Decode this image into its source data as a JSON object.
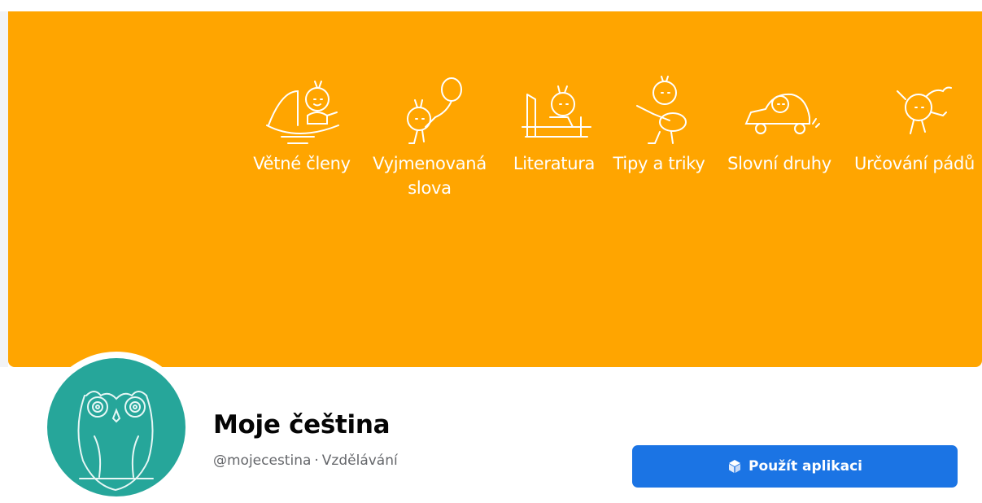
{
  "cover": {
    "background": "#FFA500",
    "categories": [
      {
        "label": "Větné členy",
        "icon": "boat-figure-icon"
      },
      {
        "label": "Vyjmenovaná slova",
        "icon": "balloon-figure-icon"
      },
      {
        "label": "Literatura",
        "icon": "reading-figure-icon"
      },
      {
        "label": "Tipy a triky",
        "icon": "guitar-figure-icon"
      },
      {
        "label": "Slovní druhy",
        "icon": "car-figure-icon"
      },
      {
        "label": "Určování pádů",
        "icon": "falling-figure-icon"
      }
    ]
  },
  "profile": {
    "name": "Moje čeština",
    "handle": "@mojecestina",
    "separator": "·",
    "category": "Vzdělávání",
    "avatar_icon": "owl-icon",
    "avatar_color": "#26A69A"
  },
  "actions": {
    "use_app_label": "Použít aplikaci",
    "use_app_icon": "cube-icon",
    "button_color": "#1B74E4"
  }
}
